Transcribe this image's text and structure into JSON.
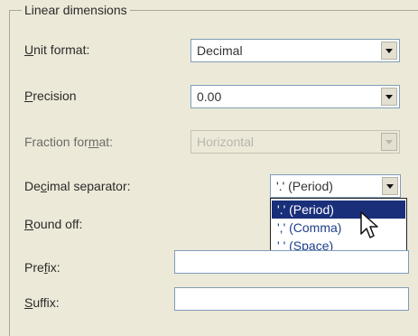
{
  "group": {
    "title": "Linear dimensions"
  },
  "unit_format": {
    "label": "Unit format:",
    "value": "Decimal"
  },
  "precision": {
    "label": "Precision",
    "value": "0.00"
  },
  "fraction_format": {
    "label": "Fraction format:",
    "value": "Horizontal"
  },
  "decimal_separator": {
    "label": "Decimal separator:",
    "value": "'.' (Period)",
    "options": [
      "'.' (Period)",
      "',' (Comma)",
      "' ' (Space)"
    ]
  },
  "round_off": {
    "label": "Round off:"
  },
  "prefix": {
    "label": "Prefix:",
    "value": ""
  },
  "suffix": {
    "label": "Suffix:",
    "value": ""
  }
}
